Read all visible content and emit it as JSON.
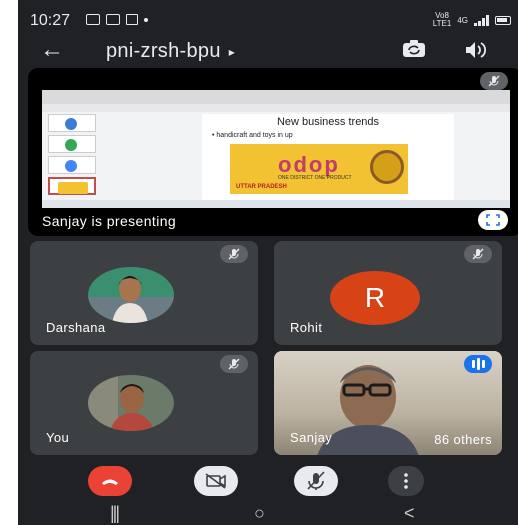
{
  "status": {
    "time": "10:27",
    "network": "VoLTE 4G",
    "right_label_top": "Vo8",
    "right_label_bottom": "LTE1",
    "signal_label": "4G"
  },
  "topbar": {
    "title": "pni-zrsh-bpu",
    "caret": "▸",
    "back_icon": "arrow-back-icon",
    "camera_icon": "switch-camera-icon",
    "speaker_icon": "speaker-icon"
  },
  "presentation": {
    "label": "Sanjay is presenting",
    "slide_title": "New business trends",
    "slide_bullet": "• handicraft and toys in up",
    "banner_main": "odop",
    "banner_sub": "ONE DISTRICT ONE PRODUCT",
    "banner_state": "UTTAR PRADESH"
  },
  "participants": [
    {
      "name": "Darshana",
      "muted": true
    },
    {
      "name": "Rohit",
      "initial": "R",
      "muted": true
    },
    {
      "name": "You",
      "muted": true
    },
    {
      "name": "Sanjay",
      "speaking": true
    }
  ],
  "others_label": "86 others",
  "controls": {
    "end_call": "end-call-icon",
    "camera_off": "camera-off-icon",
    "mic_off": "mic-off-icon",
    "more": "more-vert-icon"
  },
  "nav": {
    "recents": "|||",
    "home": "○",
    "back": "<"
  },
  "colors": {
    "background": "#202124",
    "tile": "#3c4043",
    "end_call": "#ea4335",
    "avatar_r": "#d84315",
    "speaking": "#1a73e8"
  }
}
